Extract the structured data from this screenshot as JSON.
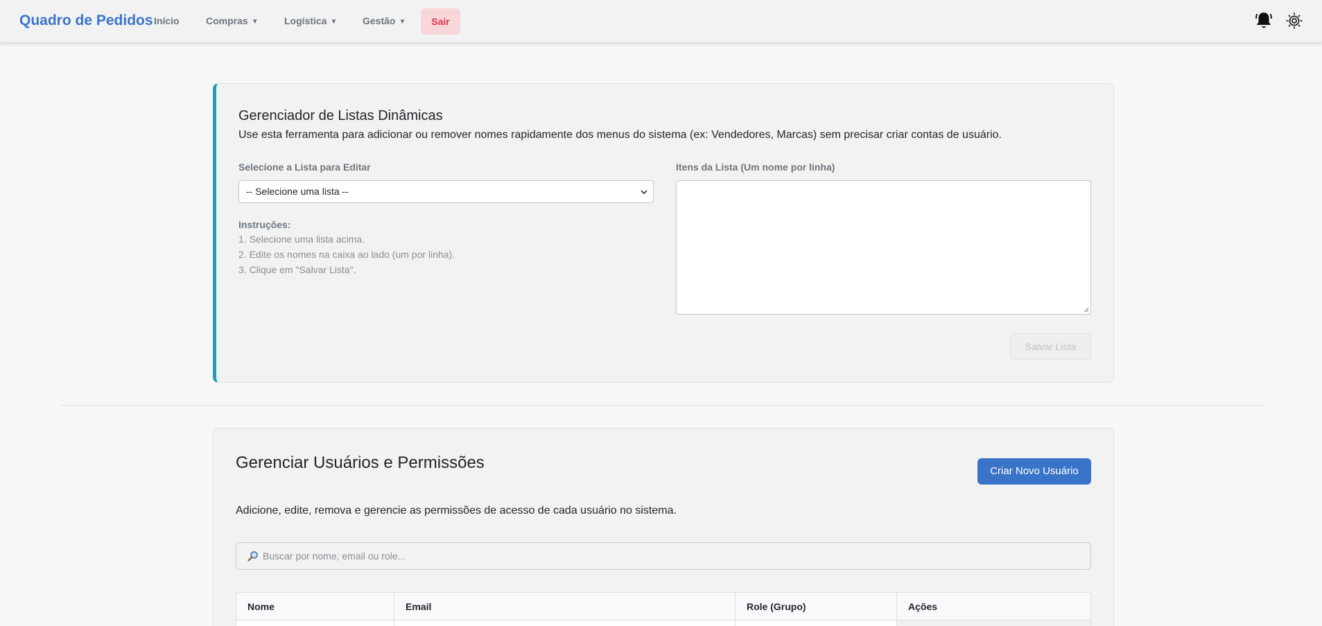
{
  "navbar": {
    "brand": "Quadro de Pedidos",
    "links": [
      {
        "label": "Início"
      },
      {
        "label": "Compras",
        "caret": "▼"
      },
      {
        "label": "Logística",
        "caret": "▼"
      },
      {
        "label": "Gestão",
        "caret": "▼"
      }
    ],
    "logout_label": "Sair",
    "icons": [
      "bell-icon",
      "gear-icon"
    ]
  },
  "lists_manager": {
    "title": "Gerenciador de Listas Dinâmicas",
    "description": "Use esta ferramenta para adicionar ou remover nomes rapidamente dos menus do sistema (ex: Vendedores, Marcas) sem precisar criar contas de usuário.",
    "select_label": "Selecione a Lista para Editar",
    "select_value": "-- Selecione uma lista --",
    "instructions_title": "Instruções:",
    "instructions": [
      "1. Selecione uma lista acima.",
      "2. Edite os nomes na caixa ao lado (um por linha).",
      "3. Clique em \"Salvar Lista\"."
    ],
    "items_label": "Itens da Lista (Um nome por linha)",
    "items_value": "",
    "save_label": "Salvar Lista",
    "accent_color": "#17a2b8"
  },
  "users": {
    "title": "Gerenciar Usuários e Permissões",
    "create_label": "Criar Novo Usuário",
    "description": "Adicione, edite, remova e gerencie as permissões de acesso de cada usuário no sistema.",
    "search_placeholder": "Buscar por nome, email ou role...",
    "columns": [
      "Nome",
      "Email",
      "Role (Grupo)",
      "Ações"
    ]
  },
  "colors": {
    "brand": "#3a74c9",
    "logout_bg": "#f8d7da",
    "logout_text": "#dc3545"
  }
}
